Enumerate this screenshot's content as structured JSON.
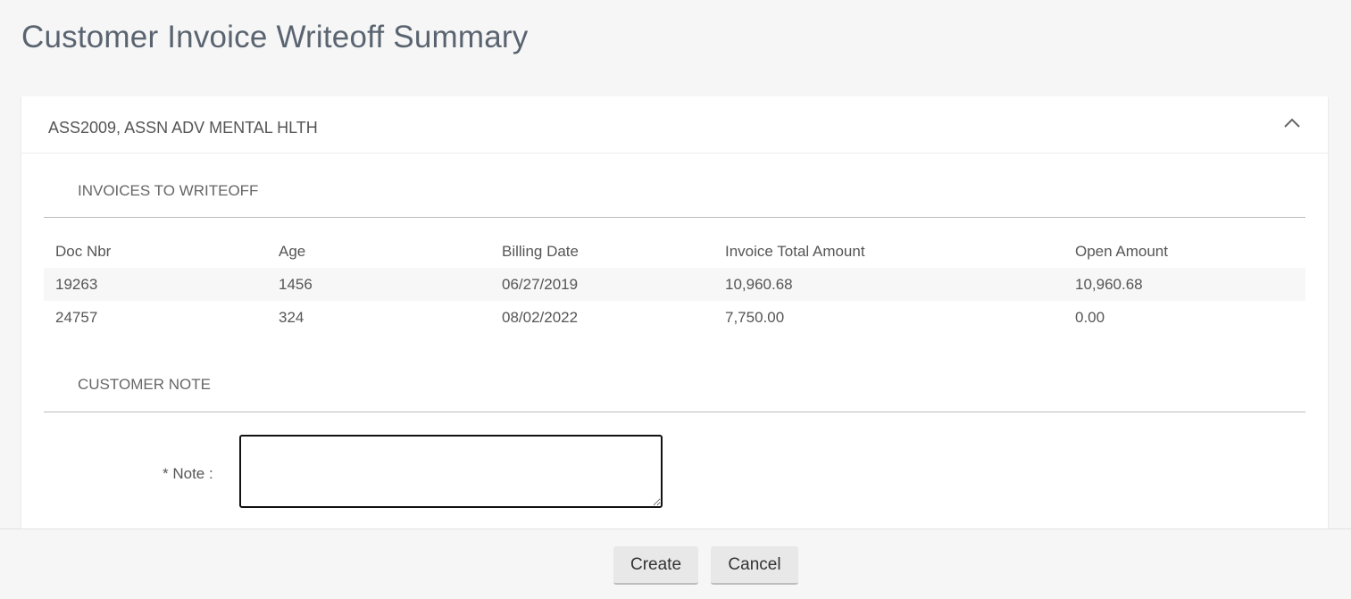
{
  "page": {
    "title": "Customer Invoice Writeoff Summary"
  },
  "panel": {
    "customer": "ASS2009, ASSN ADV MENTAL HLTH",
    "collapse_icon": "chevron-up-icon"
  },
  "invoices": {
    "section_title": "INVOICES TO WRITEOFF",
    "columns": [
      "Doc Nbr",
      "Age",
      "Billing Date",
      "Invoice Total Amount",
      "Open Amount"
    ],
    "rows": [
      [
        "19263",
        "1456",
        "06/27/2019",
        "10,960.68",
        "10,960.68"
      ],
      [
        "24757",
        "324",
        "08/02/2022",
        "7,750.00",
        "0.00"
      ]
    ]
  },
  "note": {
    "section_title": "CUSTOMER NOTE",
    "label": "* Note :",
    "value": ""
  },
  "footer": {
    "create_label": "Create",
    "cancel_label": "Cancel"
  }
}
